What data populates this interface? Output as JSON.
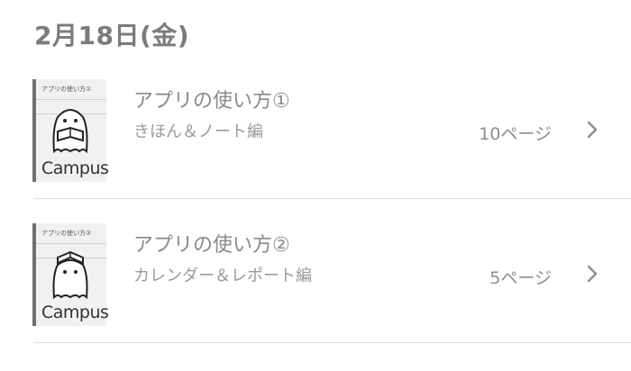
{
  "date_header": "2月18日(金)",
  "notebooks": [
    {
      "title": "アプリの使い方①",
      "subtitle": "きほん＆ノート編",
      "pages": "10ページ",
      "cover_title": "アプリの使い方①",
      "brand": "Campus",
      "illustration": "ghost-reading-book"
    },
    {
      "title": "アプリの使い方②",
      "subtitle": "カレンダー＆レポート編",
      "pages": "5ページ",
      "cover_title": "アプリの使い方②",
      "brand": "Campus",
      "illustration": "ghost-with-book-on-head"
    }
  ],
  "icons": {
    "chevron": "chevron-right-icon"
  },
  "colors": {
    "text_primary": "#8a8a8a",
    "divider": "#dedede",
    "cover_bg": "#f1f1f1"
  }
}
